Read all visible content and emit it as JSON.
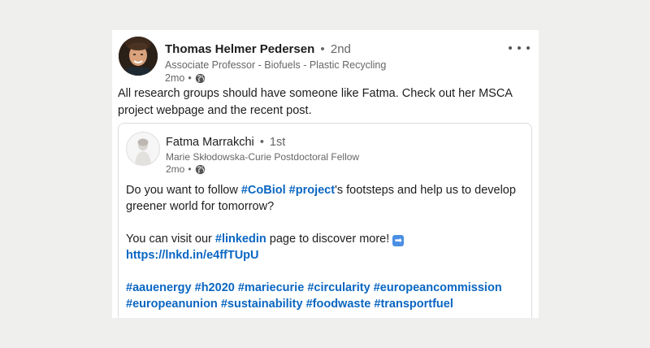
{
  "post": {
    "author": "Thomas Helmer Pedersen",
    "separator": "•",
    "degree": "2nd",
    "headline": "Associate Professor - Biofuels - Plastic Recycling",
    "time": "2mo",
    "meta_sep": "•",
    "visibility_icon": "globe-icon",
    "more_icon": "more-horizontal-icon",
    "text": "All research groups should have someone like Fatma. Check out her MSCA project webpage and the recent post."
  },
  "reshared": {
    "author": "Fatma Marrakchi",
    "separator": "•",
    "degree": "1st",
    "headline": "Marie Skłodowska-Curie Postdoctoral Fellow",
    "time": "2mo",
    "meta_sep": "•",
    "visibility_icon": "globe-icon",
    "line1_a": "Do you want to follow ",
    "tag_cobiol": "#CoBiol",
    "tag_project": "#project",
    "line1_b": "'s footsteps and help us to develop greener world for tomorrow?",
    "line2_a": "You can visit our ",
    "tag_linkedin": "#linkedin",
    "line2_b": " page to discover more! ",
    "arrow_icon": "arrow-right-emoji-icon",
    "arrow_glyph": "➡",
    "url": "https://lnkd.in/e4ffTUpU",
    "hashtags": [
      "#aauenergy",
      "#h2020",
      "#mariecurie",
      "#circularity",
      "#europeancommission",
      "#europeanunion",
      "#sustainability",
      "#foodwaste",
      "#transportfuel"
    ]
  },
  "colors": {
    "link": "#0a66c2",
    "background": "#efefed",
    "card": "#ffffff",
    "secondary_text": "#666666"
  }
}
